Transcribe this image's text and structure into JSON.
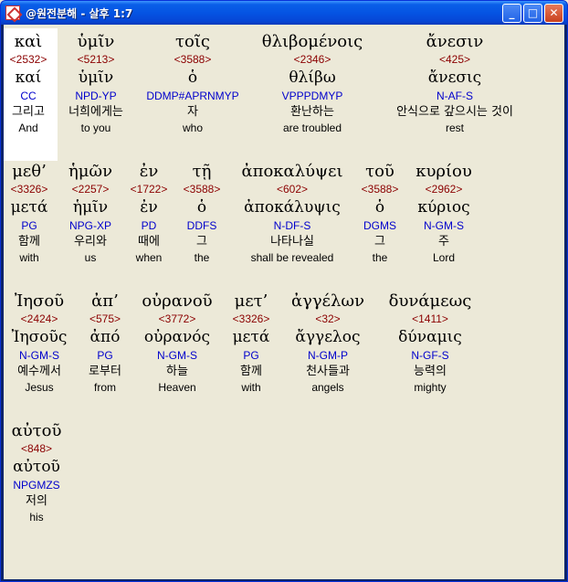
{
  "window": {
    "title": "@원전분해 - 살후 1:7",
    "minimize_glyph": "_",
    "maximize_glyph": "□",
    "close_glyph": "✕"
  },
  "rows": [
    [
      {
        "greek": "καὶ",
        "strong": "<2532>",
        "lemma": "καί",
        "parse": "CC",
        "korean": "그리고",
        "english": "And"
      },
      {
        "greek": "ὑμῖν",
        "strong": "<5213>",
        "lemma": "ὑμῖν",
        "parse": "NPD-YP",
        "korean": "너희에게는",
        "english": "to you"
      },
      {
        "greek": "τοῖς",
        "strong": "<3588>",
        "lemma": "ὁ",
        "parse": "DDMP#APRNMYP",
        "korean": "자",
        "english": "who"
      },
      {
        "greek": "θλιβομένοις",
        "strong": "<2346>",
        "lemma": "θλίβω",
        "parse": "VPPPDMYP",
        "korean": "환난하는",
        "english": "are troubled"
      },
      {
        "greek": "ἄνεσιν",
        "strong": "<425>",
        "lemma": "ἄνεσις",
        "parse": "N-AF-S",
        "korean": "안식으로 갚으시는 것이",
        "english": "rest"
      }
    ],
    [
      {
        "greek": "μεθ’",
        "strong": "<3326>",
        "lemma": "μετά",
        "parse": "PG",
        "korean": "함께",
        "english": "with"
      },
      {
        "greek": "ἡμῶν",
        "strong": "<2257>",
        "lemma": "ἡμῖν",
        "parse": "NPG-XP",
        "korean": "우리와",
        "english": "us"
      },
      {
        "greek": "ἐν",
        "strong": "<1722>",
        "lemma": "ἐν",
        "parse": "PD",
        "korean": "때에",
        "english": "when"
      },
      {
        "greek": "τῇ",
        "strong": "<3588>",
        "lemma": "ὁ",
        "parse": "DDFS",
        "korean": "그",
        "english": "the"
      },
      {
        "greek": "ἀποκαλύψει",
        "strong": "<602>",
        "lemma": "ἀποκάλυψις",
        "parse": "N-DF-S",
        "korean": "나타나실",
        "english": "shall be revealed"
      },
      {
        "greek": "τοῦ",
        "strong": "<3588>",
        "lemma": "ὁ",
        "parse": "DGMS",
        "korean": "그",
        "english": "the"
      },
      {
        "greek": "κυρίου",
        "strong": "<2962>",
        "lemma": "κύριος",
        "parse": "N-GM-S",
        "korean": "주",
        "english": "Lord"
      }
    ],
    [
      {
        "greek": "Ἰησοῦ",
        "strong": "<2424>",
        "lemma": "Ἰησοῦς",
        "parse": "N-GM-S",
        "korean": "예수께서",
        "english": "Jesus"
      },
      {
        "greek": "ἀπ’",
        "strong": "<575>",
        "lemma": "ἀπό",
        "parse": "PG",
        "korean": "로부터",
        "english": "from"
      },
      {
        "greek": "οὐρανοῦ",
        "strong": "<3772>",
        "lemma": "οὐρανός",
        "parse": "N-GM-S",
        "korean": "하늘",
        "english": "Heaven"
      },
      {
        "greek": "μετ’",
        "strong": "<3326>",
        "lemma": "μετά",
        "parse": "PG",
        "korean": "함께",
        "english": "with"
      },
      {
        "greek": "ἀγγέλων",
        "strong": "<32>",
        "lemma": "ἄγγελος",
        "parse": "N-GM-P",
        "korean": "천사들과",
        "english": "angels"
      },
      {
        "greek": "δυνάμεως",
        "strong": "<1411>",
        "lemma": "δύναμις",
        "parse": "N-GF-S",
        "korean": "능력의",
        "english": "mighty"
      }
    ],
    [
      {
        "greek": "αὐτοῦ",
        "strong": "<848>",
        "lemma": "αὐτοῦ",
        "parse": "NPGMZS",
        "korean": "저의",
        "english": "his"
      }
    ]
  ]
}
